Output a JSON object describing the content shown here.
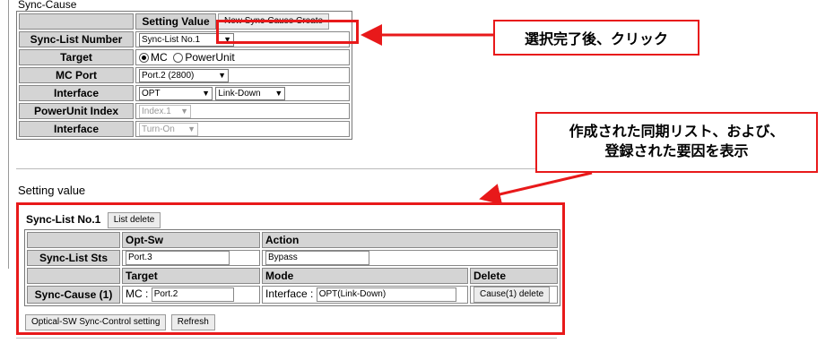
{
  "sync_cause": {
    "title": "Sync-Cause",
    "header_setting_value": "Setting Value",
    "new_button": "New Sync-Cause Create",
    "rows": {
      "sync_list_number": {
        "label": "Sync-List Number",
        "value": "Sync-List No.1"
      },
      "target": {
        "label": "Target",
        "opt1": "MC",
        "opt2": "PowerUnit"
      },
      "mc_port": {
        "label": "MC Port",
        "value": "Port.2 (2800)"
      },
      "interface": {
        "label": "Interface",
        "value1": "OPT",
        "value2": "Link-Down"
      },
      "powerunit_index": {
        "label": "PowerUnit Index",
        "value": "Index.1"
      },
      "interface2": {
        "label": "Interface",
        "value": "Turn-On"
      }
    }
  },
  "setting_value": {
    "title": "Setting value",
    "list_label": "Sync-List No.1",
    "list_delete": "List delete",
    "col_opt_sw": "Opt-Sw",
    "col_action": "Action",
    "row_sts_label": "Sync-List Sts",
    "sts_port": "Port.3",
    "sts_action": "Bypass",
    "col_target": "Target",
    "col_mode": "Mode",
    "col_delete": "Delete",
    "cause_label": "Sync-Cause (1)",
    "cause_target_prefix": "MC :",
    "cause_target": "Port.2",
    "cause_mode_prefix": "Interface :",
    "cause_mode": "OPT(Link-Down)",
    "cause_delete": "Cause(1) delete",
    "btn_control": "Optical-SW Sync-Control setting",
    "btn_refresh": "Refresh"
  },
  "annotations": {
    "callout1": "選択完了後、クリック",
    "callout2_line1": "作成された同期リスト、および、",
    "callout2_line2": "登録された要因を表示"
  },
  "colors": {
    "annotation_red": "#e8191a",
    "header_gray": "#d4d4d4"
  }
}
